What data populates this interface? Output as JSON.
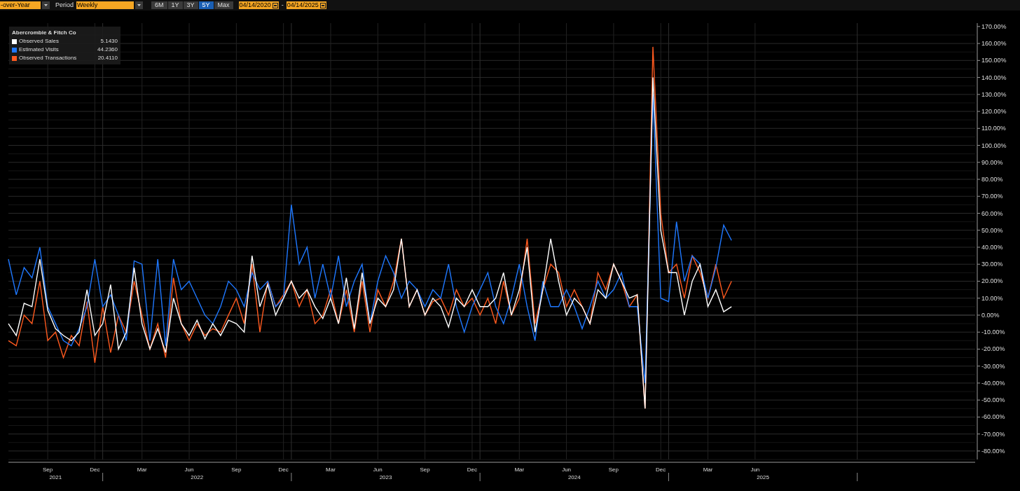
{
  "toolbar": {
    "view_dropdown": "-over-Year",
    "period_label": "Period",
    "period_dropdown": "Weekly",
    "ranges": [
      {
        "label": "6M",
        "selected": false
      },
      {
        "label": "1Y",
        "selected": false
      },
      {
        "label": "3Y",
        "selected": false
      },
      {
        "label": "5Y",
        "selected": true
      },
      {
        "label": "Max",
        "selected": false
      }
    ],
    "start_date": "04/14/2020",
    "date_separator": "-",
    "end_date": "04/14/2025"
  },
  "legend": {
    "title": "Abercrombie & Fitch Co",
    "values": [
      "5.1430",
      "44.2360",
      "20.4110"
    ]
  },
  "chart": {
    "year_labels": [
      "2021",
      "2022",
      "2023",
      "2024",
      "2025"
    ],
    "chart_data": {
      "type": "line",
      "grid": true,
      "ylim": [
        -85,
        172
      ],
      "yticks": [
        {
          "value": 170,
          "label": "170.00%"
        },
        {
          "value": 160,
          "label": "160.00%"
        },
        {
          "value": 150,
          "label": "150.00%"
        },
        {
          "value": 140,
          "label": "140.00%"
        },
        {
          "value": 130,
          "label": "130.00%"
        },
        {
          "value": 120,
          "label": "120.00%"
        },
        {
          "value": 110,
          "label": "110.00%"
        },
        {
          "value": 100,
          "label": "100.00%"
        },
        {
          "value": 90,
          "label": "90.00%"
        },
        {
          "value": 80,
          "label": "80.00%"
        },
        {
          "value": 70,
          "label": "70.00%"
        },
        {
          "value": 60,
          "label": "60.00%"
        },
        {
          "value": 50,
          "label": "50.00%"
        },
        {
          "value": 40,
          "label": "40.00%"
        },
        {
          "value": 30,
          "label": "30.00%"
        },
        {
          "value": 20,
          "label": "20.00%"
        },
        {
          "value": 10,
          "label": "10.00%"
        },
        {
          "value": 0,
          "label": "0.00%"
        },
        {
          "value": -10,
          "label": "-10.00%"
        },
        {
          "value": -20,
          "label": "-20.00%"
        },
        {
          "value": -30,
          "label": "-30.00%"
        },
        {
          "value": -40,
          "label": "-40.00%"
        },
        {
          "value": -50,
          "label": "-50.00%"
        },
        {
          "value": -60,
          "label": "-60.00%"
        },
        {
          "value": -70,
          "label": "-70.00%"
        },
        {
          "value": -80,
          "label": "-80.00%"
        }
      ],
      "categories": [
        null,
        null,
        null,
        null,
        null,
        "Sep",
        null,
        null,
        null,
        null,
        null,
        "Dec",
        null,
        null,
        null,
        null,
        null,
        "Mar",
        null,
        null,
        null,
        null,
        null,
        "Jun",
        null,
        null,
        null,
        null,
        null,
        "Sep",
        null,
        null,
        null,
        null,
        null,
        "Dec",
        null,
        null,
        null,
        null,
        null,
        "Mar",
        null,
        null,
        null,
        null,
        null,
        "Jun",
        null,
        null,
        null,
        null,
        null,
        "Sep",
        null,
        null,
        null,
        null,
        null,
        "Dec",
        null,
        null,
        null,
        null,
        null,
        "Mar",
        null,
        null,
        null,
        null,
        null,
        "Jun",
        null,
        null,
        null,
        null,
        null,
        "Sep",
        null,
        null,
        null,
        null,
        null,
        "Dec",
        null,
        null,
        null,
        null,
        null,
        "Mar",
        null,
        null,
        null,
        null,
        null,
        "Jun"
      ],
      "series": [
        {
          "name": "Observed Sales",
          "color": "#ffffff",
          "values": [
            -5,
            -12,
            7,
            5,
            33,
            3,
            -8,
            -12,
            -15,
            -10,
            15,
            -12,
            -5,
            18,
            -20,
            -10,
            28,
            -5,
            -20,
            -8,
            -22,
            10,
            -5,
            -12,
            -3,
            -14,
            -5,
            -12,
            -3,
            -5,
            -10,
            35,
            5,
            18,
            0,
            10,
            20,
            10,
            15,
            5,
            -2,
            10,
            -5,
            22,
            -8,
            25,
            -5,
            10,
            5,
            15,
            45,
            5,
            15,
            0,
            10,
            5,
            -7,
            10,
            5,
            15,
            5,
            5,
            10,
            25,
            0,
            15,
            40,
            -10,
            15,
            45,
            20,
            0,
            10,
            5,
            -5,
            15,
            10,
            30,
            20,
            10,
            12,
            -55,
            140,
            50,
            25,
            25,
            0,
            20,
            30,
            5,
            15,
            2,
            5,
            null,
            null,
            null
          ]
        },
        {
          "name": "Estimated Visits",
          "color": "#1f78ff",
          "values": [
            33,
            12,
            28,
            22,
            40,
            5,
            -5,
            -15,
            -18,
            -8,
            5,
            33,
            5,
            12,
            0,
            -15,
            32,
            30,
            -15,
            33,
            -18,
            33,
            15,
            20,
            10,
            0,
            -5,
            5,
            20,
            15,
            5,
            25,
            15,
            20,
            5,
            10,
            65,
            30,
            40,
            10,
            30,
            10,
            35,
            5,
            20,
            30,
            -5,
            20,
            35,
            25,
            10,
            20,
            15,
            5,
            15,
            10,
            30,
            5,
            -10,
            5,
            15,
            25,
            5,
            -5,
            10,
            30,
            5,
            -15,
            20,
            5,
            5,
            15,
            5,
            -8,
            5,
            20,
            10,
            15,
            25,
            5,
            5,
            -40,
            130,
            10,
            8,
            55,
            20,
            35,
            30,
            10,
            28,
            53,
            44,
            null,
            null,
            null
          ]
        },
        {
          "name": "Observed Transactions",
          "color": "#ff5a1f",
          "values": [
            -15,
            -18,
            0,
            -5,
            20,
            -15,
            -10,
            -25,
            -12,
            -18,
            8,
            -28,
            5,
            -22,
            0,
            -10,
            20,
            0,
            -20,
            -5,
            -25,
            22,
            -5,
            -15,
            -5,
            -12,
            -8,
            -10,
            0,
            10,
            -5,
            30,
            -10,
            20,
            5,
            12,
            20,
            5,
            15,
            -5,
            0,
            15,
            -5,
            15,
            -10,
            20,
            -10,
            15,
            5,
            20,
            45,
            5,
            15,
            0,
            8,
            10,
            0,
            15,
            5,
            10,
            0,
            10,
            -5,
            20,
            0,
            10,
            45,
            -5,
            15,
            30,
            25,
            5,
            15,
            5,
            -5,
            25,
            15,
            30,
            20,
            5,
            12,
            -55,
            158,
            60,
            25,
            30,
            10,
            35,
            25,
            10,
            30,
            10,
            20,
            null,
            null,
            null
          ]
        }
      ]
    }
  }
}
